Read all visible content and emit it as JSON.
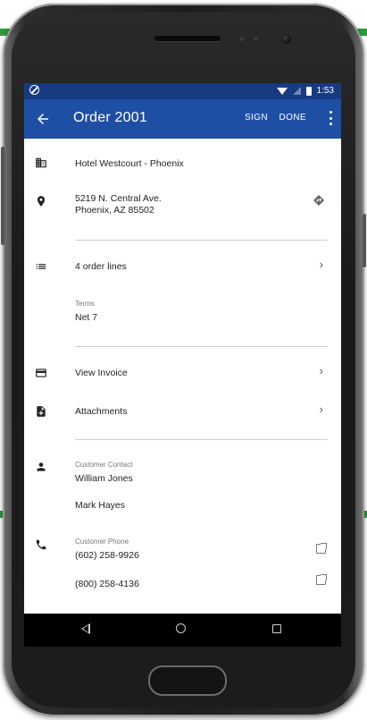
{
  "status_bar": {
    "time": "1:53"
  },
  "app_bar": {
    "title": "Order 2001",
    "sign_label": "SIGN",
    "done_label": "DONE"
  },
  "order": {
    "hotel": "Hotel Westcourt - Phoenix",
    "address_line1": "5219 N. Central Ave.",
    "address_line2": "Phoenix, AZ 85502",
    "order_lines": "4 order lines",
    "terms_label": "Terms",
    "terms_value": "Net 7",
    "view_invoice": "View Invoice",
    "attachments": "Attachments",
    "contact_label": "Customer Contact",
    "contacts": [
      "William Jones",
      "Mark Hayes"
    ],
    "phone_label": "Customer Phone",
    "phones": [
      "(602) 258-9926",
      "(800) 258-4136"
    ]
  },
  "colors": {
    "app_bar": "#1f4fa5",
    "status_bar": "#173b80",
    "accent_band": "#2e9a3a"
  },
  "icons": {
    "building": "business-icon",
    "location": "location-pin-icon",
    "directions": "directions-icon",
    "list": "list-icon",
    "card": "credit-card-icon",
    "attachment": "add-file-icon",
    "person": "person-icon",
    "phone": "phone-icon",
    "open": "open-in-new-icon"
  }
}
